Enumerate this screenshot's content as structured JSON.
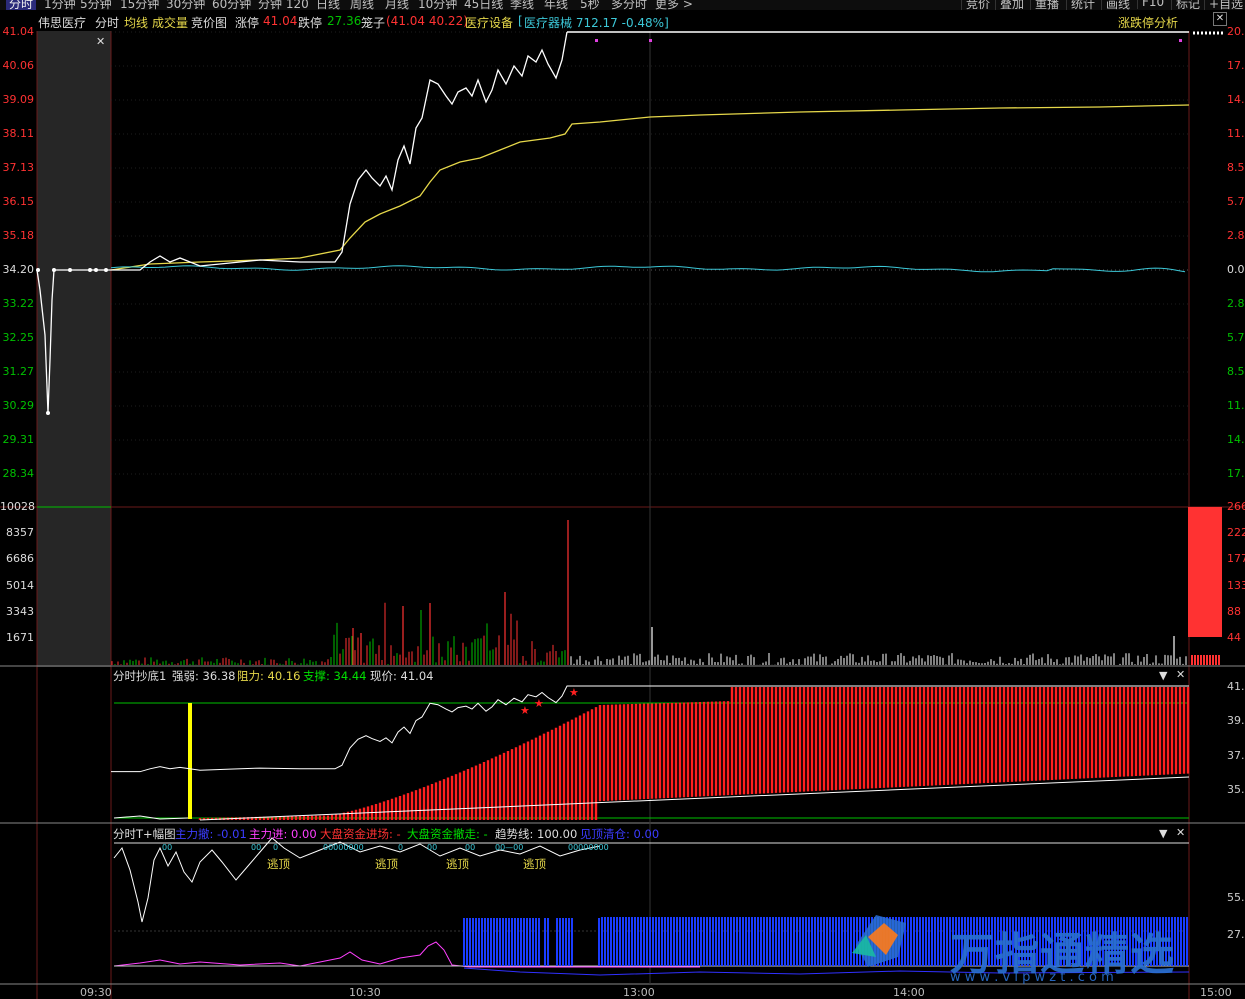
{
  "top_menu": {
    "left": [
      "分时",
      "1分钟",
      "5分钟",
      "15分钟",
      "30分钟",
      "60分钟",
      "分钟 120",
      "日线",
      "周线",
      "月线",
      "10分钟",
      "45日线",
      "季线",
      "年线",
      "5秒",
      "多分时",
      "更多 >"
    ],
    "right": [
      "竞价",
      "叠加",
      "重播",
      "统计",
      "画线",
      "F10",
      "标记",
      "+自选"
    ]
  },
  "header": {
    "stock_name": "伟思医疗",
    "tab_fenshi": "分时",
    "tab_junxian": "均线",
    "tab_chengjiaoliang": "成交量",
    "tab_jingjiatu": "竞价图",
    "limit_up_label": "涨停",
    "limit_up_value": "41.04",
    "limit_down_label": "跌停",
    "limit_down_value": "27.36",
    "cage_label": "笼子",
    "cage_value": "(41.04 40.22)",
    "sector": "医疗设备",
    "index_text": "医疗器械 712.17 -0.48%]",
    "index_open": "[",
    "analysis_link": "涨跌停分析"
  },
  "price_axis": [
    "41.04",
    "40.06",
    "39.09",
    "38.11",
    "37.13",
    "36.15",
    "35.18",
    "34.20",
    "33.22",
    "32.25",
    "31.27",
    "30.29",
    "29.31",
    "28.34"
  ],
  "pct_axis": [
    "20.",
    "17.",
    "14.",
    "11.",
    "8.5",
    "5.7",
    "2.8",
    "0.0",
    "2.8",
    "5.7",
    "8.5",
    "11.",
    "14.",
    "17."
  ],
  "volume_axis": [
    "10028",
    "8357",
    "6686",
    "5014",
    "3343",
    "1671"
  ],
  "volume_right_axis": [
    "266",
    "222",
    "177",
    "133",
    "88",
    "44"
  ],
  "panel1": {
    "title": "分时抄底1",
    "strength": "强弱: 36.38",
    "resistance": "阻力: 40.16",
    "support": "支撑: 34.44",
    "price": "现价: 41.04",
    "axis": [
      "41.",
      "39.",
      "37.",
      "35."
    ],
    "signals": [
      "★",
      "★",
      "★"
    ]
  },
  "panel2": {
    "title": "分时T+幅图",
    "main_force_sell": "主力撤: -0.01",
    "main_force_in": "主力进: 0.00",
    "market_in": "大盘资金进场: -",
    "market_out": "大盘资金撤走: -",
    "trend": "趋势线: 100.00",
    "top_clear": "见顶清仓: 0.00",
    "escape_labels": [
      "逃顶",
      "逃顶",
      "逃顶",
      "逃顶"
    ],
    "axis": [
      "55.",
      "27."
    ]
  },
  "time_axis": [
    "09:30",
    "10:30",
    "13:00",
    "14:00",
    "15:00"
  ],
  "watermark": {
    "brand": "万指通精选",
    "url": "w w w . v i p w z t . c o m"
  },
  "colors": {
    "up": "#ff3232",
    "down": "#00c000",
    "avg": "#e6d84a",
    "index": "#3cc8d8",
    "bg": "#000000"
  }
}
